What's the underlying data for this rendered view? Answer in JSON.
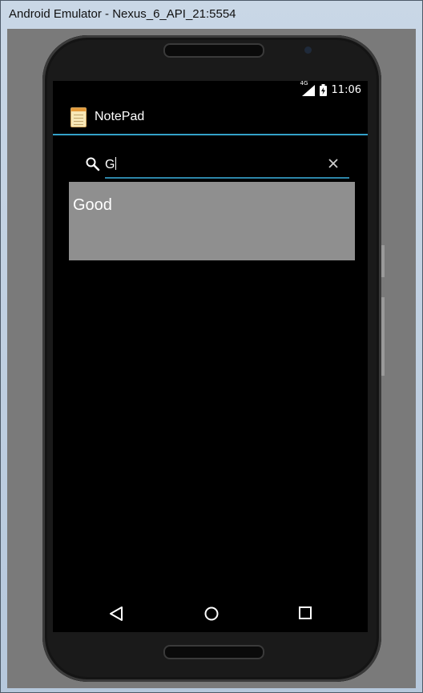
{
  "window": {
    "title": "Android Emulator - Nexus_6_API_21:5554"
  },
  "status_bar": {
    "network": "4G",
    "time": "11:06"
  },
  "action_bar": {
    "title": "NotePad",
    "icon": "notepad-icon"
  },
  "search": {
    "query": "G",
    "icons": [
      "search-icon",
      "clear-icon"
    ]
  },
  "results": [
    {
      "title": "Good"
    }
  ],
  "nav_bar": {
    "icons": [
      "back-icon",
      "home-icon",
      "recents-icon"
    ]
  },
  "colors": {
    "accent": "#33a1c9",
    "result_background": "#8f8f8f",
    "screen": "#000000"
  }
}
